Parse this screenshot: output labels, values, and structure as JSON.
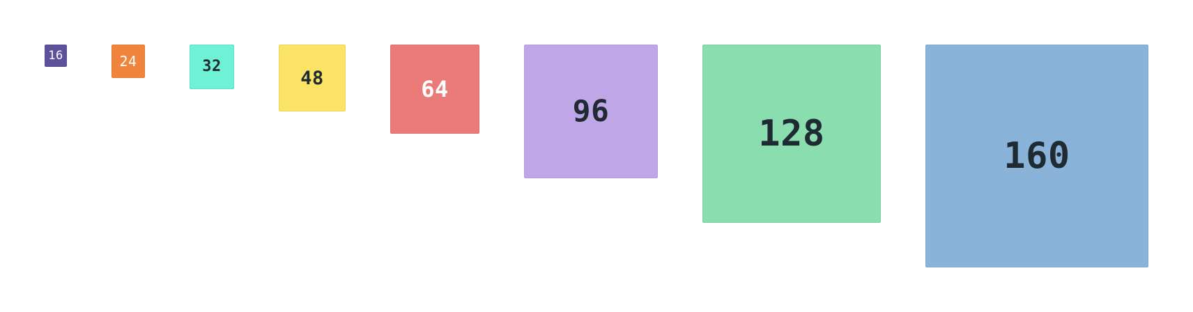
{
  "boxes": [
    {
      "label": "16",
      "size": 16,
      "color": "#5e519b",
      "text_color": "#ffffff"
    },
    {
      "label": "24",
      "size": 24,
      "color": "#f0843c",
      "text_color": "#ffffff"
    },
    {
      "label": "32",
      "size": 32,
      "color": "#6ef2d6",
      "text_color": "#1f2a33"
    },
    {
      "label": "48",
      "size": 48,
      "color": "#fbe365",
      "text_color": "#1f2a33"
    },
    {
      "label": "64",
      "size": 64,
      "color": "#e97a78",
      "text_color": "#ffffff"
    },
    {
      "label": "96",
      "size": 96,
      "color": "#bfa7e7",
      "text_color": "#1f2a33"
    },
    {
      "label": "128",
      "size": 128,
      "color": "#89ddae",
      "text_color": "#1f2a33"
    },
    {
      "label": "160",
      "size": 160,
      "color": "#8ab3da",
      "text_color": "#1f2a33"
    }
  ]
}
